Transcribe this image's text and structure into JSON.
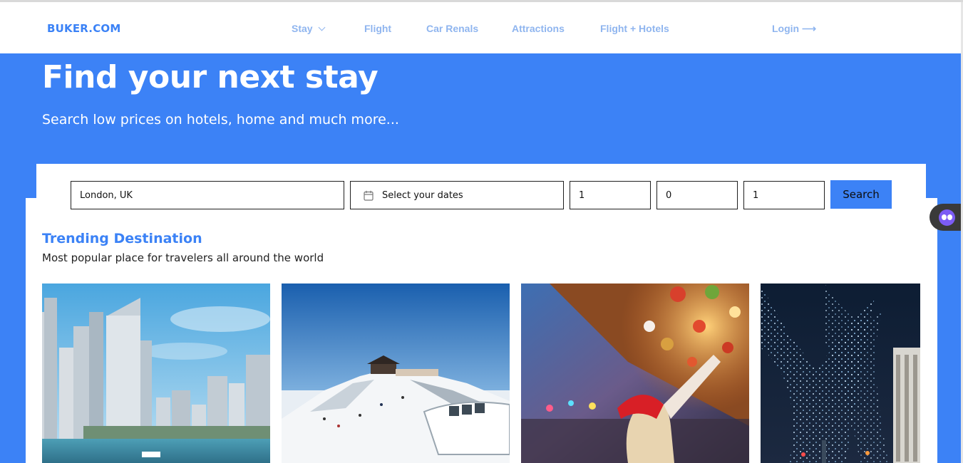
{
  "brand": {
    "logo": "BUKER.COM",
    "accent_color": "#3c82f6"
  },
  "nav": {
    "items": [
      {
        "label": "Stay",
        "has_dropdown": true
      },
      {
        "label": "Flight"
      },
      {
        "label": "Car Renals"
      },
      {
        "label": "Attractions"
      },
      {
        "label": "Flight + Hotels"
      }
    ],
    "login_label": "Login ⟶"
  },
  "hero": {
    "title": "Find your next stay",
    "subtitle": "Search low prices on hotels, home and much more..."
  },
  "search": {
    "destination": "London, UK",
    "dates_placeholder": "Select your dates",
    "dates_icon": "calendar-icon",
    "adults": "1",
    "children": "0",
    "rooms": "1",
    "button_label": "Search"
  },
  "trending": {
    "title": "Trending Destination",
    "subtitle": "Most popular place for travelers all around the world",
    "cards": [
      {
        "image": "city-skyline-waterfront"
      },
      {
        "image": "snowy-mountain-pavilion"
      },
      {
        "image": "christmas-market-ornaments"
      },
      {
        "image": "illuminated-winter-trees"
      }
    ]
  },
  "extension": {
    "icon": "assistant-bot-icon"
  }
}
